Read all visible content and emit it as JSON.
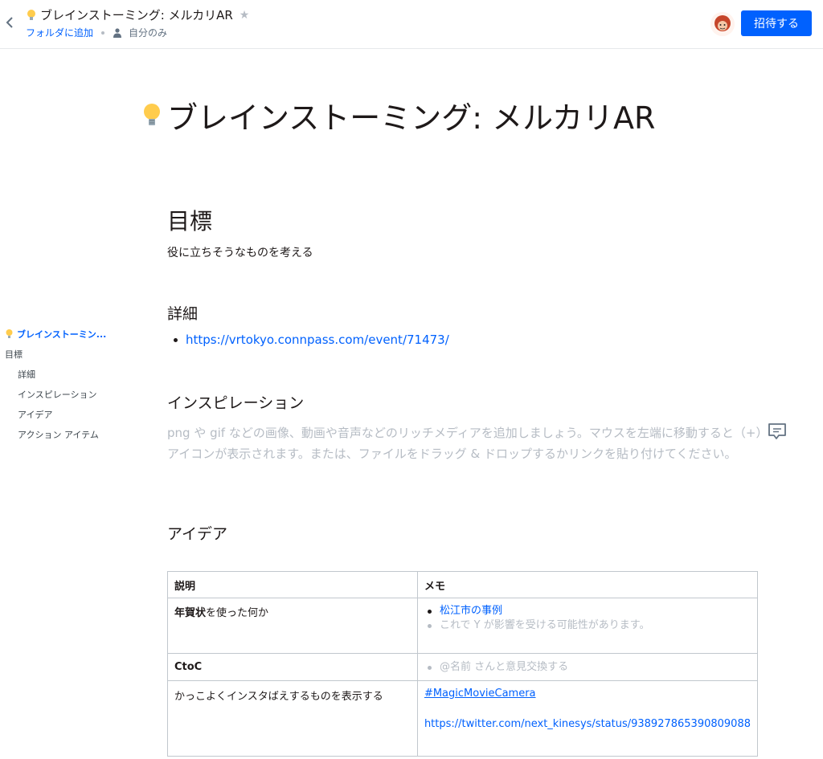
{
  "header": {
    "title": "ブレインストーミング: メルカリAR",
    "folder_link": "フォルダに追加",
    "visibility": "自分のみ",
    "invite_button": "招待する"
  },
  "document": {
    "title": "ブレインストーミング: メルカリAR",
    "goal_heading": "目標",
    "goal_text": "役に立ちそうなものを考える",
    "detail_heading": "詳細",
    "detail_link": "https://vrtokyo.connpass.com/event/71473/",
    "inspiration_heading": "インスピレーション",
    "inspiration_placeholder": "png や gif などの画像、動画や音声などのリッチメディアを追加しましょう。マウスを左端に移動すると（+）アイコンが表示されます。または、ファイルをドラッグ & ドロップするかリンクを貼り付けてください。",
    "idea_heading": "アイデア"
  },
  "toc": {
    "items": [
      "ブレインストーミン...",
      "目標",
      "詳細",
      "インスピレーション",
      "アイデア",
      "アクション アイテム"
    ]
  },
  "table": {
    "headers": [
      "説明",
      "メモ"
    ],
    "row1": {
      "desc_bold": "年賀状",
      "desc_rest": "を使った何か",
      "memo_link": "松江市の事例",
      "memo_gray": "これで Y が影響を受ける可能性があります。"
    },
    "row2": {
      "desc": "CtoC",
      "memo_gray": "@名前 さんと意見交換する"
    },
    "row3": {
      "desc": "かっこよくインスタばえするものを表示する",
      "memo_hashtag": "#MagicMovieCamera",
      "memo_link": "https://twitter.com/next_kinesys/status/938927865390809088"
    }
  },
  "colors": {
    "accent": "#0061fe",
    "text": "#1e1919",
    "muted": "#b6bcc4"
  },
  "icons": [
    "chevron-left-icon",
    "lightbulb-icon",
    "star-icon",
    "person-icon",
    "comment-icon"
  ]
}
